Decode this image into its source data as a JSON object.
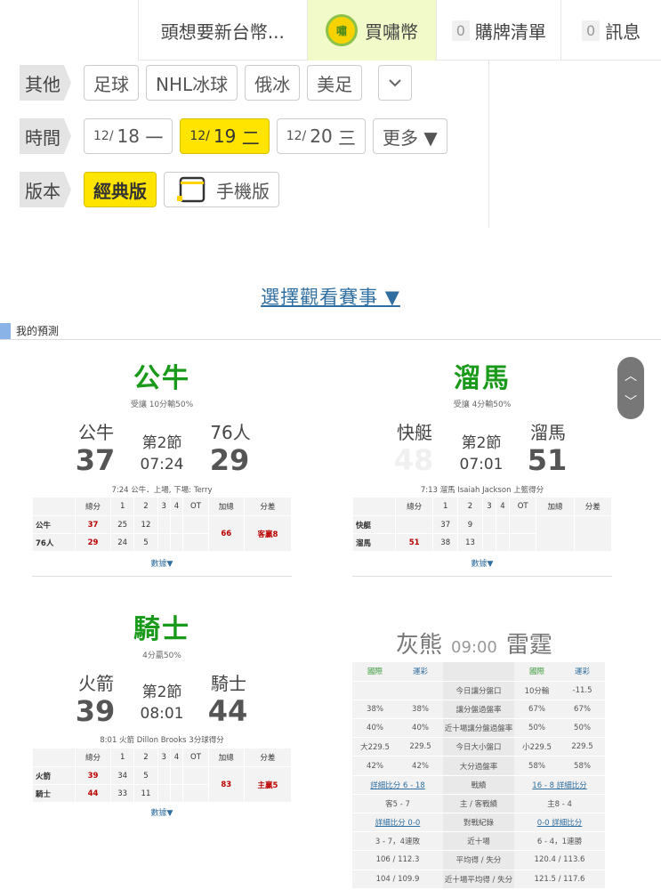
{
  "topbar": {
    "tab1": "頭想要新台幣...",
    "coin_glyph": "嘯",
    "buy": "買嘯幣",
    "cart_count": "0",
    "cart": "購牌清單",
    "msg_count": "0",
    "msg": "訊息"
  },
  "filters": {
    "other_label": "其他",
    "other_items": [
      "足球",
      "NHL冰球",
      "俄冰",
      "美足"
    ],
    "date_label": "時間",
    "dates": [
      {
        "md": "12/",
        "d": "18",
        "w": "一"
      },
      {
        "md": "12/",
        "d": "19",
        "w": "二"
      },
      {
        "md": "12/",
        "d": "20",
        "w": "三"
      }
    ],
    "more": "更多 ▼",
    "version_label": "版本",
    "classic": "經典版",
    "mobile": "手機版"
  },
  "select_link": "選擇觀看賽事 ▼",
  "section_title": "我的預測",
  "box_header": [
    "總分",
    "1",
    "2",
    "3",
    "4",
    "OT",
    "加總",
    "分差"
  ],
  "more_link": "數據▼",
  "games": [
    {
      "title": "公牛",
      "sub": "受讓 10分輸50%",
      "away": "公牛",
      "home": "76人",
      "away_score": "37",
      "home_score": "29",
      "period": "第2節",
      "clock": "07:24",
      "note": "7:24 公牛．上場, 下場: Terry",
      "rows": [
        {
          "team": "公牛",
          "total": "37",
          "q1": "25",
          "q2": "12"
        },
        {
          "team": "76人",
          "total": "29",
          "q1": "24",
          "q2": "5"
        }
      ],
      "sum": "66",
      "diff": "客贏8"
    },
    {
      "title": "溜馬",
      "sub": "受讓 4分輸50%",
      "away": "快艇",
      "home": "溜馬",
      "away_score": "48",
      "home_score": "51",
      "period": "第2節",
      "clock": "07:01",
      "note": "7:13 溜馬 Isaiah Jackson 上籃得分",
      "rows": [
        {
          "team": "快艇",
          "total": "",
          "q1": "37",
          "q2": "9"
        },
        {
          "team": "溜馬",
          "total": "51",
          "q1": "38",
          "q2": "13"
        }
      ],
      "sum": "",
      "diff": ""
    },
    {
      "title": "騎士",
      "sub": "4分贏50%",
      "away": "火箭",
      "home": "騎士",
      "away_score": "39",
      "home_score": "44",
      "period": "第2節",
      "clock": "08:01",
      "note": "8:01 火箭 Dillon Brooks 3分球得分",
      "rows": [
        {
          "team": "火箭",
          "total": "39",
          "q1": "34",
          "q2": "5"
        },
        {
          "team": "騎士",
          "total": "44",
          "q1": "33",
          "q2": "11"
        }
      ],
      "sum": "83",
      "diff": "主贏5"
    }
  ],
  "prediction": {
    "away": "灰熊",
    "time": "09:00",
    "home": "雷霆",
    "headers": [
      "國際",
      "運彩",
      "國際",
      "運彩"
    ],
    "rows": [
      [
        "",
        "",
        "今日讓分盤口",
        "10分輸",
        "-11.5"
      ],
      [
        "38%",
        "38%",
        "讓分盤過盤率",
        "67%",
        "67%"
      ],
      [
        "40%",
        "40%",
        "近十場讓分盤過盤率",
        "50%",
        "50%"
      ],
      [
        "大229.5",
        "229.5",
        "今日大小盤口",
        "小229.5",
        "229.5"
      ],
      [
        "42%",
        "42%",
        "大分過盤率",
        "58%",
        "58%"
      ],
      [
        "詳細比分 6 - 18",
        "",
        "戰績",
        "16 - 8 詳細比分",
        ""
      ],
      [
        "客5 - 7",
        "",
        "主 / 客戰績",
        "主8 - 4",
        ""
      ],
      [
        "詳細比分 0-0",
        "",
        "對戰紀錄",
        "0-0 詳細比分",
        ""
      ],
      [
        "3 - 7，4連敗",
        "",
        "近十場",
        "6 - 4，1連勝",
        ""
      ],
      [
        "106 / 112.3",
        "",
        "平均得 / 失分",
        "120.4 / 113.6",
        ""
      ],
      [
        "104 / 109.9",
        "",
        "近十場平均得 / 失分",
        "121.5 / 117.6",
        ""
      ]
    ]
  }
}
